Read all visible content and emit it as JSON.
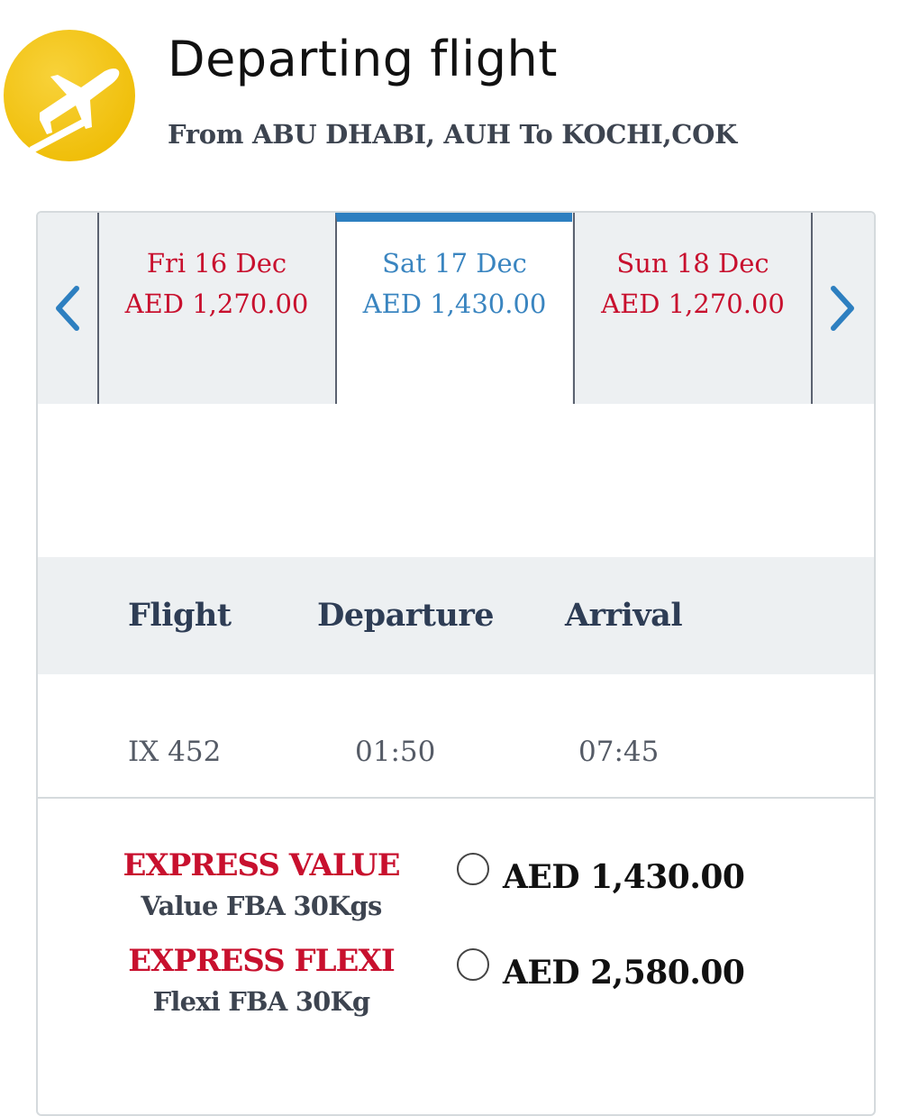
{
  "header": {
    "icon": "plane-takeoff-icon",
    "title": "Departing flight",
    "route": "From ABU DHABI, AUH To KOCHI,COK"
  },
  "date_strip": {
    "prev_icon": "chevron-left-icon",
    "next_icon": "chevron-right-icon",
    "tabs": [
      {
        "day": "Fri 16 Dec",
        "price": "AED 1,270.00",
        "selected": false
      },
      {
        "day": "Sat 17 Dec",
        "price": "AED 1,430.00",
        "selected": true
      },
      {
        "day": "Sun 18 Dec",
        "price": "AED 1,270.00",
        "selected": false
      }
    ]
  },
  "table": {
    "headers": {
      "flight": "Flight",
      "departure": "Departure",
      "arrival": "Arrival"
    },
    "row": {
      "flight": "IX 452",
      "departure": "01:50",
      "arrival": "07:45"
    }
  },
  "fares": [
    {
      "name": "EXPRESS VALUE",
      "desc": "Value FBA 30Kgs",
      "price": "AED 1,430.00",
      "selected": false
    },
    {
      "name": "EXPRESS FLEXI",
      "desc": "Flexi FBA 30Kg",
      "price": "AED 2,580.00",
      "selected": false
    }
  ],
  "colors": {
    "accent_blue": "#2d7fc0",
    "fare_red": "#c8102e",
    "header_bg": "#edf0f2",
    "icon_yellow": "#f4c20d"
  }
}
